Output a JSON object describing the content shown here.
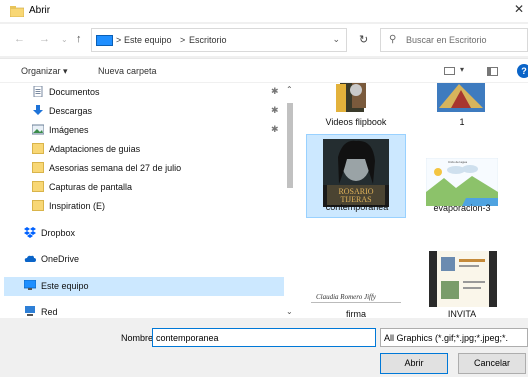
{
  "window": {
    "title": "Abrir"
  },
  "address": {
    "crumbs": [
      "Este equipo",
      "Escritorio"
    ],
    "separator": ">"
  },
  "search": {
    "placeholder": "Buscar en Escritorio"
  },
  "toolbar": {
    "organize_label": "Organizar ▾",
    "new_folder_label": "Nueva carpeta"
  },
  "sidebar": {
    "items": [
      {
        "label": "Documentos",
        "icon": "documents-icon",
        "pinned": true
      },
      {
        "label": "Descargas",
        "icon": "downloads-icon",
        "pinned": true
      },
      {
        "label": "Imágenes",
        "icon": "pictures-icon",
        "pinned": true
      },
      {
        "label": "Adaptaciones de guias",
        "icon": "folder-icon"
      },
      {
        "label": "Asesorias semana del 27 de julio",
        "icon": "folder-icon"
      },
      {
        "label": "Capturas de pantalla",
        "icon": "folder-icon"
      },
      {
        "label": "Inspiration (E)",
        "icon": "folder-icon"
      },
      {
        "label": "Dropbox",
        "icon": "dropbox-icon"
      },
      {
        "label": "OneDrive",
        "icon": "onedrive-icon"
      },
      {
        "label": "Este equipo",
        "icon": "this-pc-icon",
        "selected": true
      },
      {
        "label": "Red",
        "icon": "network-icon"
      }
    ]
  },
  "files": [
    {
      "name": "Videos flipbook"
    },
    {
      "name": "1"
    },
    {
      "name": "contemporanea",
      "selected": true
    },
    {
      "name": "evaporacion-3"
    },
    {
      "name": "firma"
    },
    {
      "name": "INVITA"
    }
  ],
  "thumbnail_text": {
    "book_title": "ROSARIO TIJERAS",
    "signature": "Claudia Romero Jiffy",
    "diagram_title": "Ciclo del agua"
  },
  "bottom": {
    "filename_label": "Nombre:",
    "filename_value": "contemporanea",
    "filter_value": "All Graphics (*.gif;*.jpg;*.jpeg;*.",
    "open_label": "Abrir",
    "cancel_label": "Cancelar"
  },
  "colors": {
    "accent": "#0078d7",
    "selection": "#cce8ff",
    "folder": "#f8d775"
  }
}
